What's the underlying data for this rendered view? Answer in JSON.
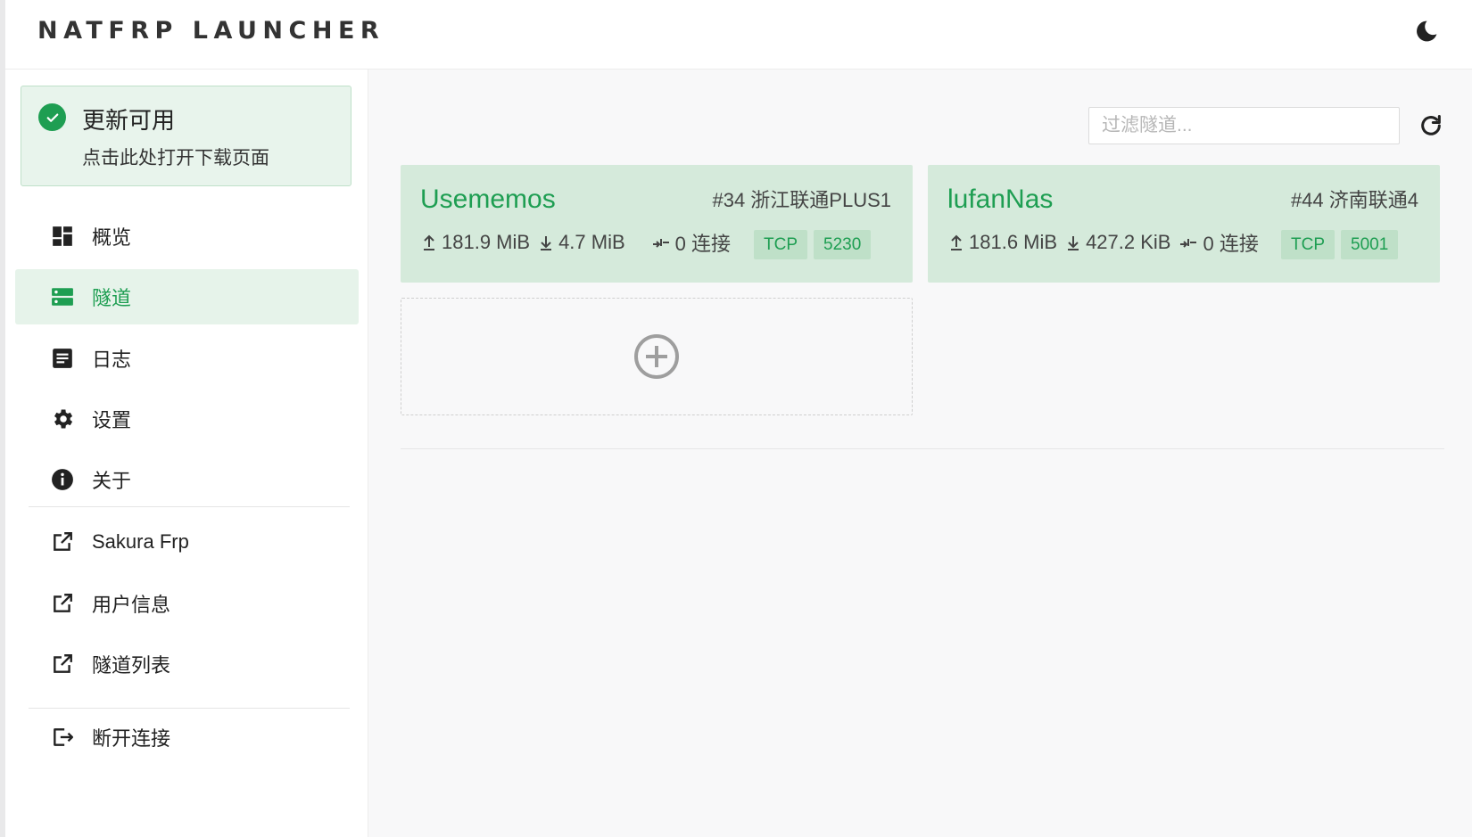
{
  "header": {
    "app_title": "NATFRP LAUNCHER",
    "theme_icon": "moon-icon"
  },
  "sidebar": {
    "update": {
      "title": "更新可用",
      "subtitle": "点击此处打开下载页面",
      "icon": "check-circle-icon"
    },
    "nav_items": [
      {
        "label": "概览",
        "icon": "dashboard-icon",
        "active": false
      },
      {
        "label": "隧道",
        "icon": "server-icon",
        "active": true
      },
      {
        "label": "日志",
        "icon": "document-icon",
        "active": false
      },
      {
        "label": "设置",
        "icon": "gear-icon",
        "active": false
      },
      {
        "label": "关于",
        "icon": "info-icon",
        "active": false
      }
    ],
    "external_links": [
      {
        "label": "Sakura Frp",
        "icon": "external-link-icon"
      },
      {
        "label": "用户信息",
        "icon": "external-link-icon"
      },
      {
        "label": "隧道列表",
        "icon": "external-link-icon"
      }
    ],
    "disconnect": {
      "label": "断开连接",
      "icon": "logout-icon"
    }
  },
  "main": {
    "filter": {
      "placeholder": "过滤隧道...",
      "value": ""
    },
    "refresh_icon": "refresh-icon",
    "tunnels": [
      {
        "name": "Usememos",
        "node": "#34 浙江联通PLUS1",
        "upload": "181.9 MiB",
        "download": "4.7 MiB",
        "connections": "0 连接",
        "protocol": "TCP",
        "port": "5230"
      },
      {
        "name": "lufanNas",
        "node": "#44 济南联通4",
        "upload": "181.6 MiB",
        "download": "427.2 KiB",
        "connections": "0 连接",
        "protocol": "TCP",
        "port": "5001"
      }
    ],
    "add_icon": "plus-circle-icon"
  },
  "colors": {
    "accent": "#1e9e52",
    "card_bg": "#d5eadb",
    "badge_bg": "#bfe0c8",
    "update_bg": "#e8f4ec"
  }
}
